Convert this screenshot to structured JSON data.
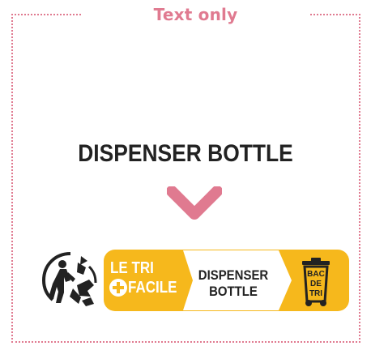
{
  "header": {
    "title": "Text only"
  },
  "product": {
    "name": "DISPENSER BOTTLE"
  },
  "badge": {
    "line1": "LE TRI",
    "line2": "FACILE",
    "item_text": "DISPENSER BOTTLE",
    "bin_label": "BAC DE TRI"
  },
  "colors": {
    "accent_pink": "#e07a90",
    "badge_yellow": "#f6b81c",
    "text_dark": "#222222"
  },
  "icons": {
    "triman": "triman-icon",
    "bin": "recycling-bin-icon",
    "chevron": "chevron-down-icon"
  }
}
